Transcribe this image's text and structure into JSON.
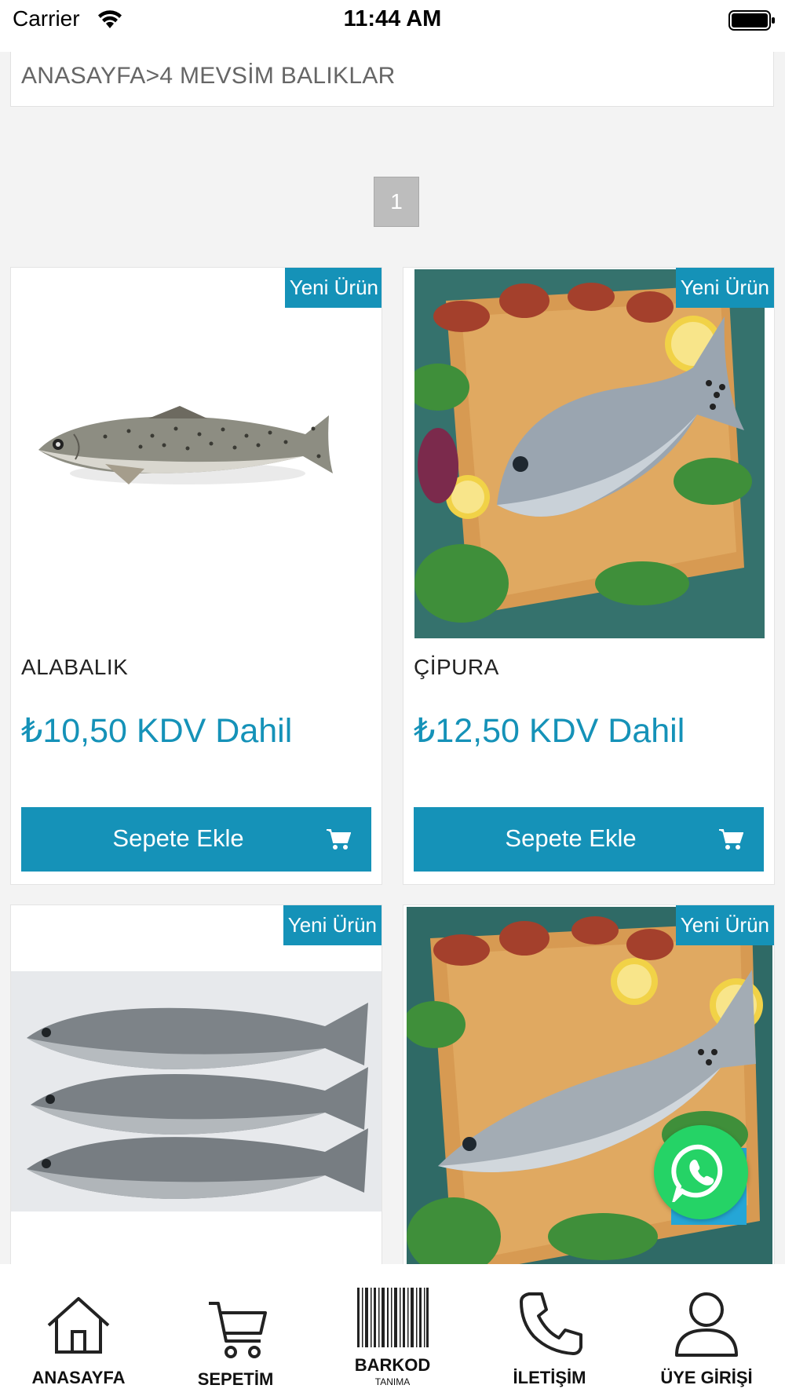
{
  "status_bar": {
    "carrier": "Carrier",
    "time": "11:44 AM"
  },
  "breadcrumb": {
    "text": "ANASAYFA>4 MEVSİM BALIKLAR"
  },
  "pagination": {
    "current_page": "1"
  },
  "products": [
    {
      "badge": "Yeni Ürün",
      "name": "ALABALIK",
      "price": "₺10,50 KDV Dahil",
      "button": "Sepete Ekle",
      "image": "trout"
    },
    {
      "badge": "Yeni Ürün",
      "name": "ÇİPURA",
      "price": "₺12,50 KDV Dahil",
      "button": "Sepete Ekle",
      "image": "sea-bream"
    },
    {
      "badge": "Yeni Ürün",
      "image": "meagre"
    },
    {
      "badge": "Yeni Ürün",
      "image": "sea-bass"
    }
  ],
  "colors": {
    "accent": "#1592b8",
    "whatsapp": "#25d366"
  },
  "bottom_nav": {
    "home": "ANASAYFA",
    "cart": "SEPETİM",
    "barcode": "BARKOD",
    "barcode_sub": "TANIMA",
    "contact": "İLETİŞİM",
    "login": "ÜYE GİRİŞİ"
  }
}
